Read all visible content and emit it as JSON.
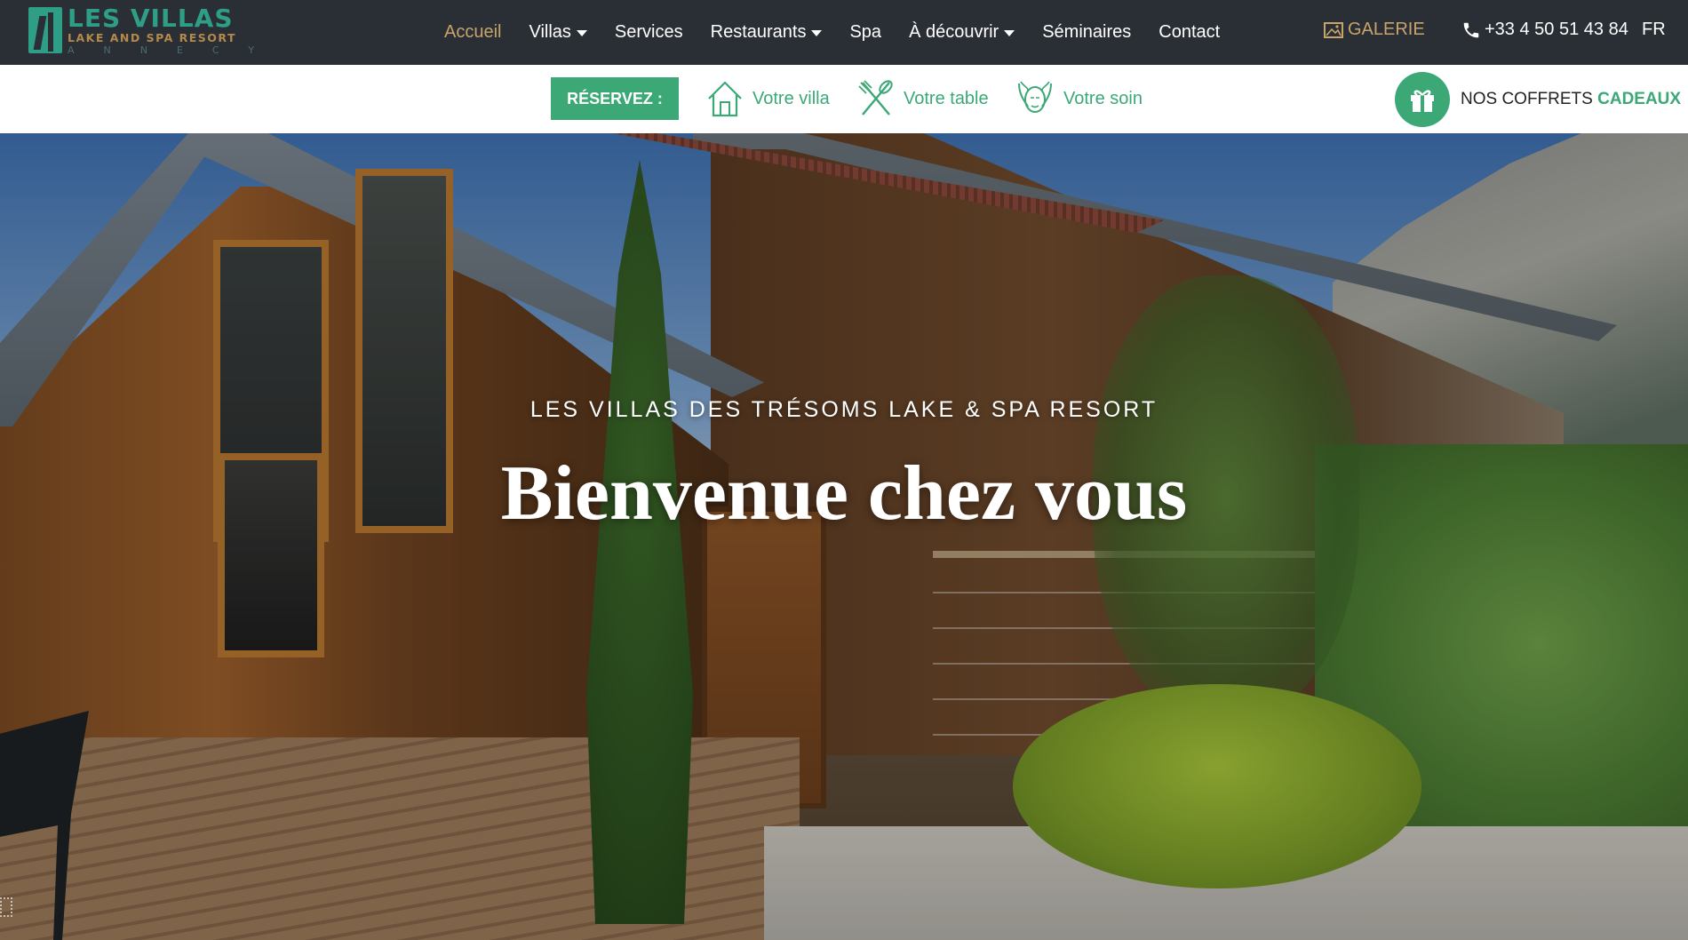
{
  "logo": {
    "title": "LES VILLAS",
    "subtitle": "LAKE AND SPA RESORT",
    "city": "ANNECY"
  },
  "nav": {
    "items": [
      {
        "label": "Accueil",
        "active": true,
        "dropdown": false
      },
      {
        "label": "Villas",
        "active": false,
        "dropdown": true
      },
      {
        "label": "Services",
        "active": false,
        "dropdown": false
      },
      {
        "label": "Restaurants",
        "active": false,
        "dropdown": true
      },
      {
        "label": "Spa",
        "active": false,
        "dropdown": false
      },
      {
        "label": "À découvrir",
        "active": false,
        "dropdown": true
      },
      {
        "label": "Séminaires",
        "active": false,
        "dropdown": false
      },
      {
        "label": "Contact",
        "active": false,
        "dropdown": false
      }
    ],
    "gallery_label": "GALERIE",
    "phone": "+33 4 50 51 43 84",
    "language": "FR"
  },
  "booking": {
    "reserve_label": "RÉSERVEZ :",
    "villa_label": "Votre villa",
    "table_label": "Votre table",
    "soin_label": "Votre soin",
    "gift_prefix": "NOS COFFRETS ",
    "gift_accent": "CADEAUX"
  },
  "hero": {
    "subtitle": "LES VILLAS DES TRÉSOMS LAKE & SPA RESORT",
    "title": "Bienvenue chez vous"
  },
  "colors": {
    "nav_bg": "#2a2f36",
    "accent_gold": "#c9a46a",
    "accent_green": "#3ca876",
    "logo_teal": "#2e9e86"
  },
  "icons": {
    "villa": "house-icon",
    "table": "fork-knife-icon",
    "soin": "face-leaf-icon",
    "gift": "gift-icon",
    "gallery": "picture-icon",
    "phone": "phone-icon"
  }
}
